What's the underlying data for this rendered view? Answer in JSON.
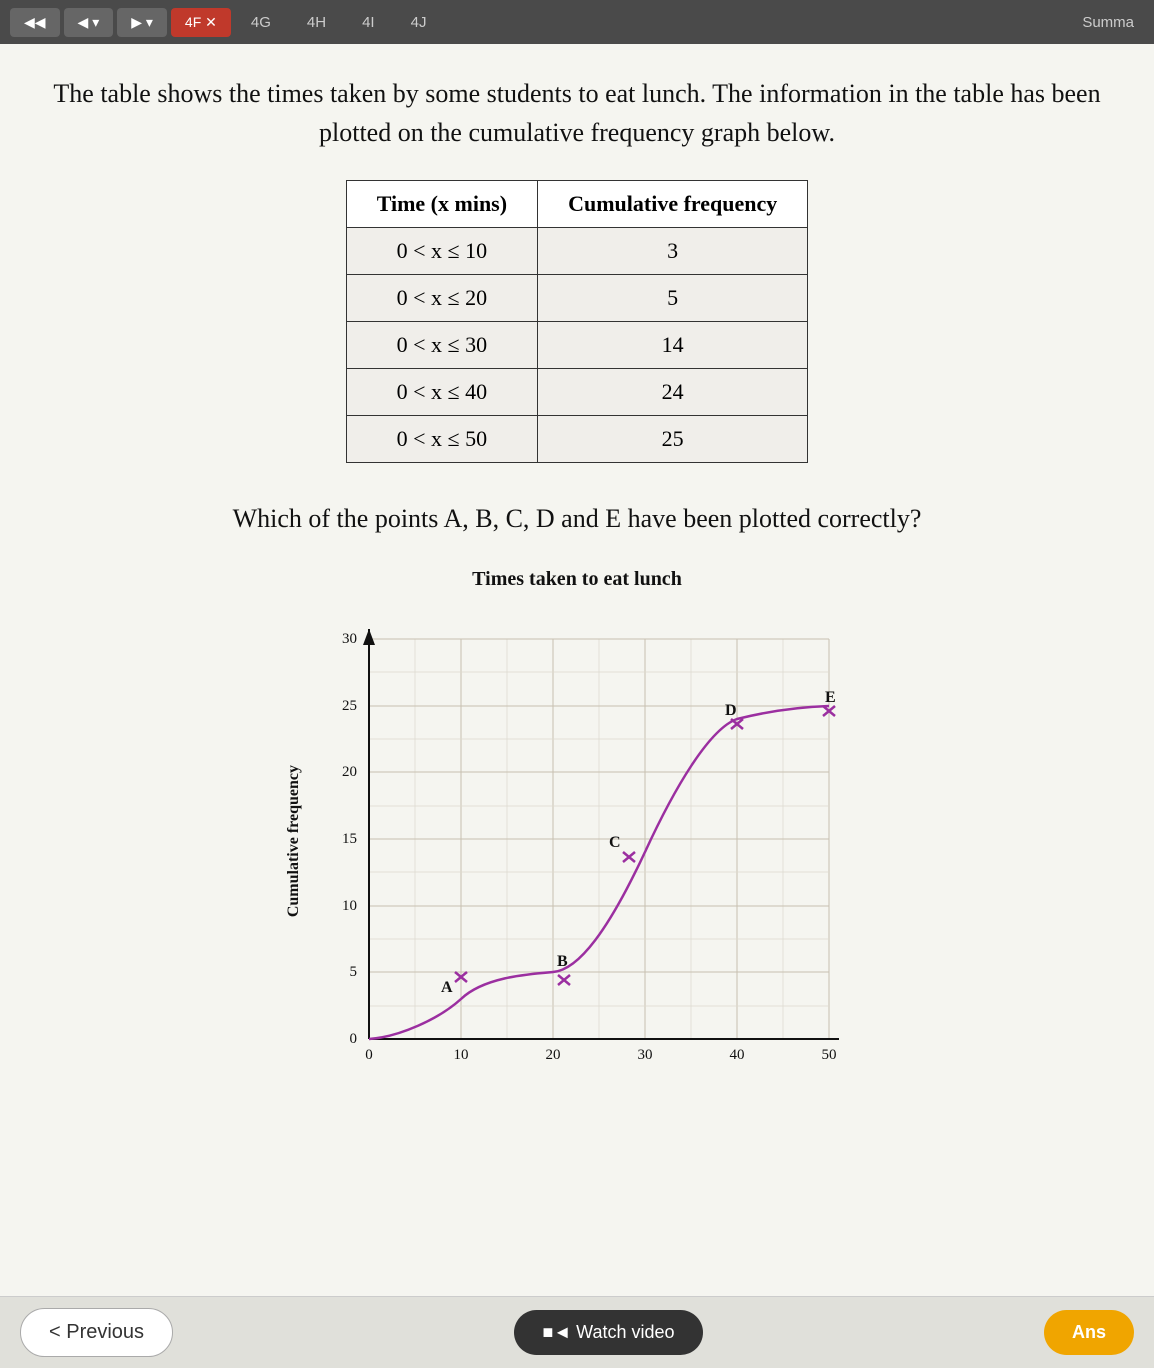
{
  "nav": {
    "tabs": [
      "4F",
      "4G",
      "4H",
      "4I",
      "4J",
      "Summa"
    ],
    "active_tab": "4F",
    "active_marker": "✕"
  },
  "problem": {
    "intro_text": "The table shows the times taken by some students to eat lunch. The information in the table has been plotted on the cumulative frequency graph below.",
    "table": {
      "col1_header": "Time (x mins)",
      "col2_header": "Cumulative frequency",
      "rows": [
        {
          "range": "0 < x ≤ 10",
          "freq": "3"
        },
        {
          "range": "0 < x ≤ 20",
          "freq": "5"
        },
        {
          "range": "0 < x ≤ 30",
          "freq": "14"
        },
        {
          "range": "0 < x ≤ 40",
          "freq": "24"
        },
        {
          "range": "0 < x ≤ 50",
          "freq": "25"
        }
      ]
    },
    "question_text": "Which of the points A, B, C, D and E have been plotted correctly?",
    "graph_title": "Times taken to eat lunch",
    "graph_y_label": "Cumulative frequency"
  },
  "buttons": {
    "previous": "< Previous",
    "watch_video": "■◄ Watch video",
    "answer": "Ans"
  },
  "colors": {
    "curve": "#9b2fa0",
    "grid": "#c8c0b0",
    "axis": "#111111",
    "point_marker": "#9b2fa0"
  }
}
